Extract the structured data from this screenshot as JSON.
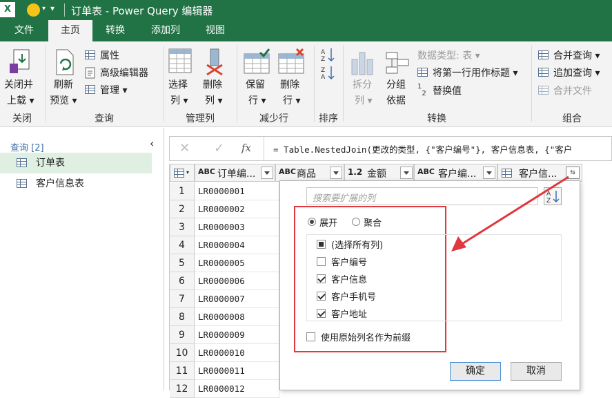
{
  "titlebar": {
    "app_badge": "X",
    "title": "订单表 - Power Query 编辑器"
  },
  "tabs": [
    "文件",
    "主页",
    "转换",
    "添加列",
    "视图"
  ],
  "ribbon": {
    "close": {
      "line1": "关闭并",
      "line2": "上载 ▾",
      "group": "关闭"
    },
    "query": {
      "refresh1": "刷新",
      "refresh2": "预览 ▾",
      "properties": "属性",
      "advanced_editor": "高级编辑器",
      "manage": "管理 ▾",
      "group": "查询"
    },
    "manage_columns": {
      "choose1": "选择",
      "choose2": "列 ▾",
      "remove1": "删除",
      "remove2": "列 ▾",
      "group": "管理列"
    },
    "reduce_rows": {
      "keep1": "保留",
      "keep2": "行 ▾",
      "remove1": "删除",
      "remove2": "行 ▾",
      "group": "减少行"
    },
    "sort": {
      "group": "排序"
    },
    "transform": {
      "split1": "拆分",
      "split2": "列 ▾",
      "groupby1": "分组",
      "groupby2": "依据",
      "data_type": "数据类型: 表 ▾",
      "first_row": "将第一行用作标题 ▾",
      "replace": "替换值",
      "group": "转换"
    },
    "combine": {
      "merge": "合并查询 ▾",
      "append": "追加查询 ▾",
      "merge_files": "合并文件",
      "group": "组合"
    }
  },
  "left_pane": {
    "header": "查询 [2]",
    "items": [
      "订单表",
      "客户信息表"
    ]
  },
  "formula_bar": {
    "cancel": "✕",
    "confirm": "✓",
    "fx": "fx",
    "text": "= Table.NestedJoin(更改的类型, {\"客户编号\"}, 客户信息表, {\"客户"
  },
  "columns": [
    {
      "type": "ABC",
      "name": "订单编..."
    },
    {
      "type": "ABC",
      "name": "商品"
    },
    {
      "type": "1.2",
      "name": "金额"
    },
    {
      "type": "ABC",
      "name": "客户编..."
    },
    {
      "type": "table",
      "name": "客户信..."
    }
  ],
  "rows": [
    {
      "n": "1",
      "id": "LR0000001"
    },
    {
      "n": "2",
      "id": "LR0000002"
    },
    {
      "n": "3",
      "id": "LR0000003"
    },
    {
      "n": "4",
      "id": "LR0000004"
    },
    {
      "n": "5",
      "id": "LR0000005"
    },
    {
      "n": "6",
      "id": "LR0000006"
    },
    {
      "n": "7",
      "id": "LR0000007"
    },
    {
      "n": "8",
      "id": "LR0000008"
    },
    {
      "n": "9",
      "id": "LR0000009"
    },
    {
      "n": "10",
      "id": "LR0000010"
    },
    {
      "n": "11",
      "id": "LR0000011"
    },
    {
      "n": "12",
      "id": "LR0000012"
    }
  ],
  "expand_popup": {
    "search_placeholder": "搜索要扩展的列",
    "expand_label": "展开",
    "aggregate_label": "聚合",
    "select_all": "(选择所有列)",
    "options": [
      {
        "label": "客户编号",
        "checked": false
      },
      {
        "label": "客户信息",
        "checked": true
      },
      {
        "label": "客户手机号",
        "checked": true
      },
      {
        "label": "客户地址",
        "checked": true
      }
    ],
    "prefix_label": "使用原始列名作为前缀",
    "ok": "确定",
    "cancel": "取消"
  },
  "colors": {
    "excel_green": "#217346",
    "highlight_red": "#e0383e",
    "selected_query": "#dff0e3"
  }
}
